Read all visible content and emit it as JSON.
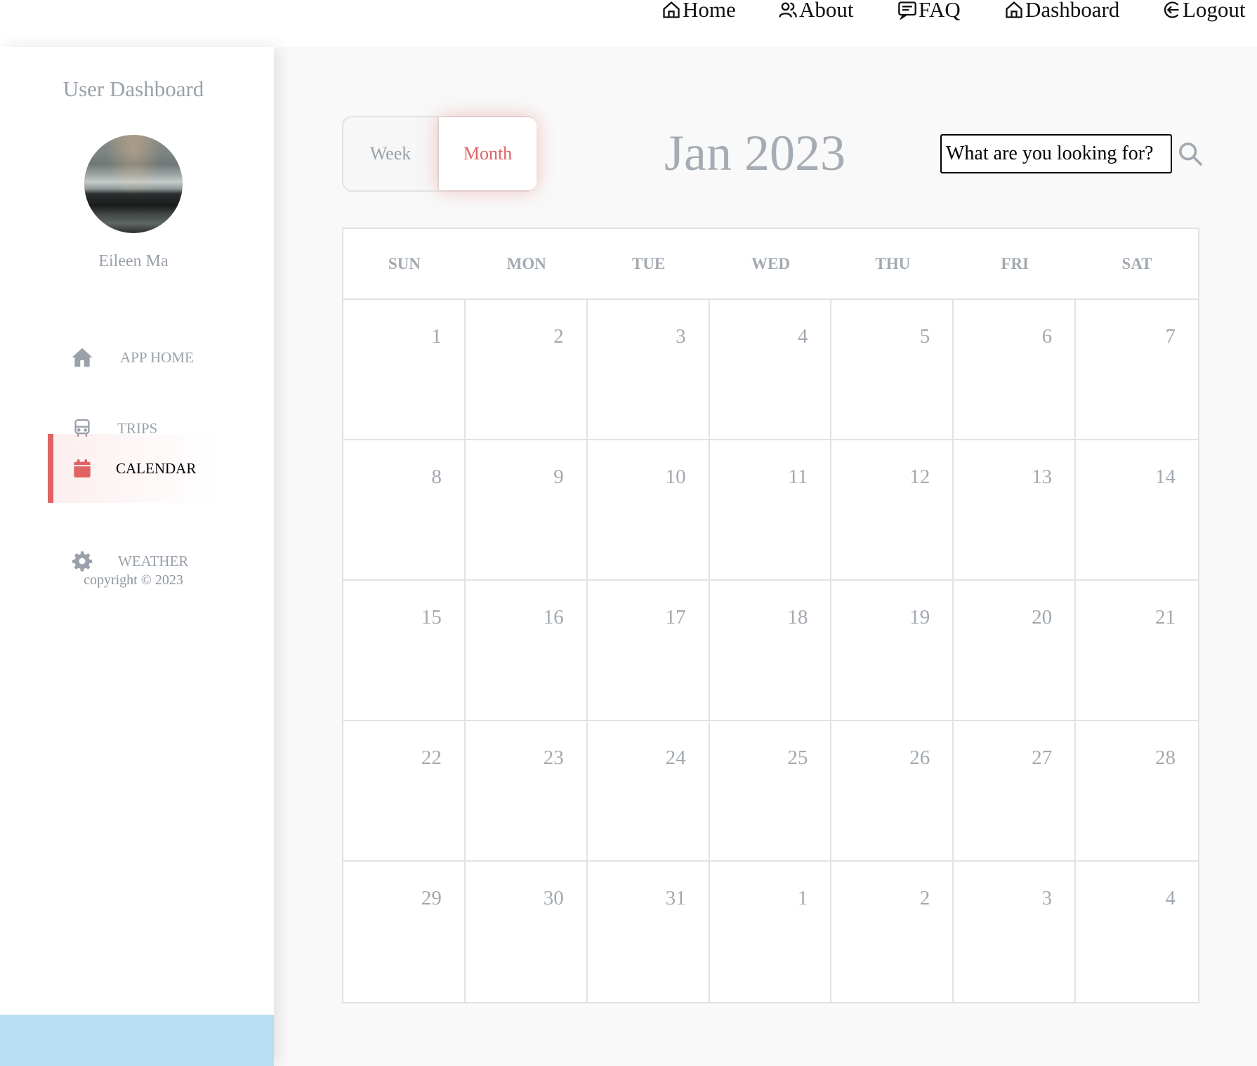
{
  "nav": {
    "links": [
      {
        "label": "Home",
        "icon": "home-icon"
      },
      {
        "label": "About",
        "icon": "users-icon"
      },
      {
        "label": "FAQ",
        "icon": "faq-icon"
      },
      {
        "label": "Dashboard",
        "icon": "home-icon"
      },
      {
        "label": "Logout",
        "icon": "logout-icon"
      }
    ]
  },
  "sidebar": {
    "title": "User Dashboard",
    "user_name": "Eileen Ma",
    "items": [
      {
        "label": "APP HOME",
        "icon": "house-icon",
        "active": false
      },
      {
        "label": "TRIPS",
        "icon": "bus-icon",
        "active": false
      },
      {
        "label": "CALENDAR",
        "icon": "calendar-icon",
        "active": true
      },
      {
        "label": "WEATHER",
        "icon": "gear-icon",
        "active": false
      }
    ],
    "copyright": "copyright © 2023"
  },
  "main": {
    "view_toggle": {
      "week": "Week",
      "month": "Month",
      "selected": "Month"
    },
    "month_title": "Jan 2023",
    "search": {
      "placeholder": "What are you looking for?",
      "value": ""
    },
    "calendar": {
      "weekdays": [
        "SUN",
        "MON",
        "TUE",
        "WED",
        "THU",
        "FRI",
        "SAT"
      ],
      "days": [
        "1",
        "2",
        "3",
        "4",
        "5",
        "6",
        "7",
        "8",
        "9",
        "10",
        "11",
        "12",
        "13",
        "14",
        "15",
        "16",
        "17",
        "18",
        "19",
        "20",
        "21",
        "22",
        "23",
        "24",
        "25",
        "26",
        "27",
        "28",
        "29",
        "30",
        "31",
        "1",
        "2",
        "3",
        "4"
      ]
    }
  },
  "colors": {
    "accent": "#e06262",
    "muted_text": "#9aa1aa",
    "footer": "#b7dff1"
  }
}
